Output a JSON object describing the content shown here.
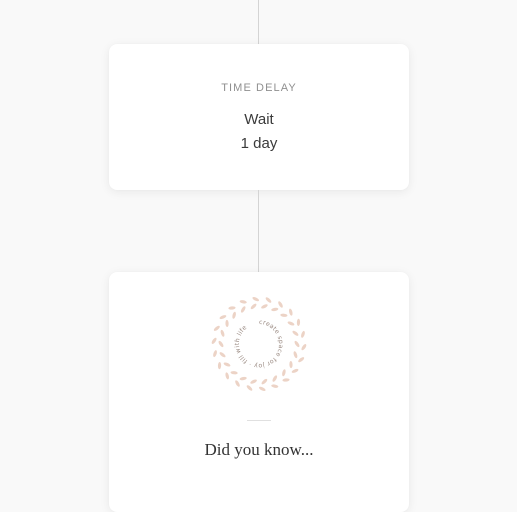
{
  "delay_card": {
    "label": "TIME DELAY",
    "wait_text": "Wait",
    "duration_text": "1 day"
  },
  "tip_card": {
    "wreath_text": "create space for joy · fill with life",
    "title": "Did you know..."
  },
  "colors": {
    "background": "#f9f9f9",
    "card": "#ffffff",
    "connector": "#d4d4d4",
    "wreath_leaf": "#ecd3c6"
  }
}
